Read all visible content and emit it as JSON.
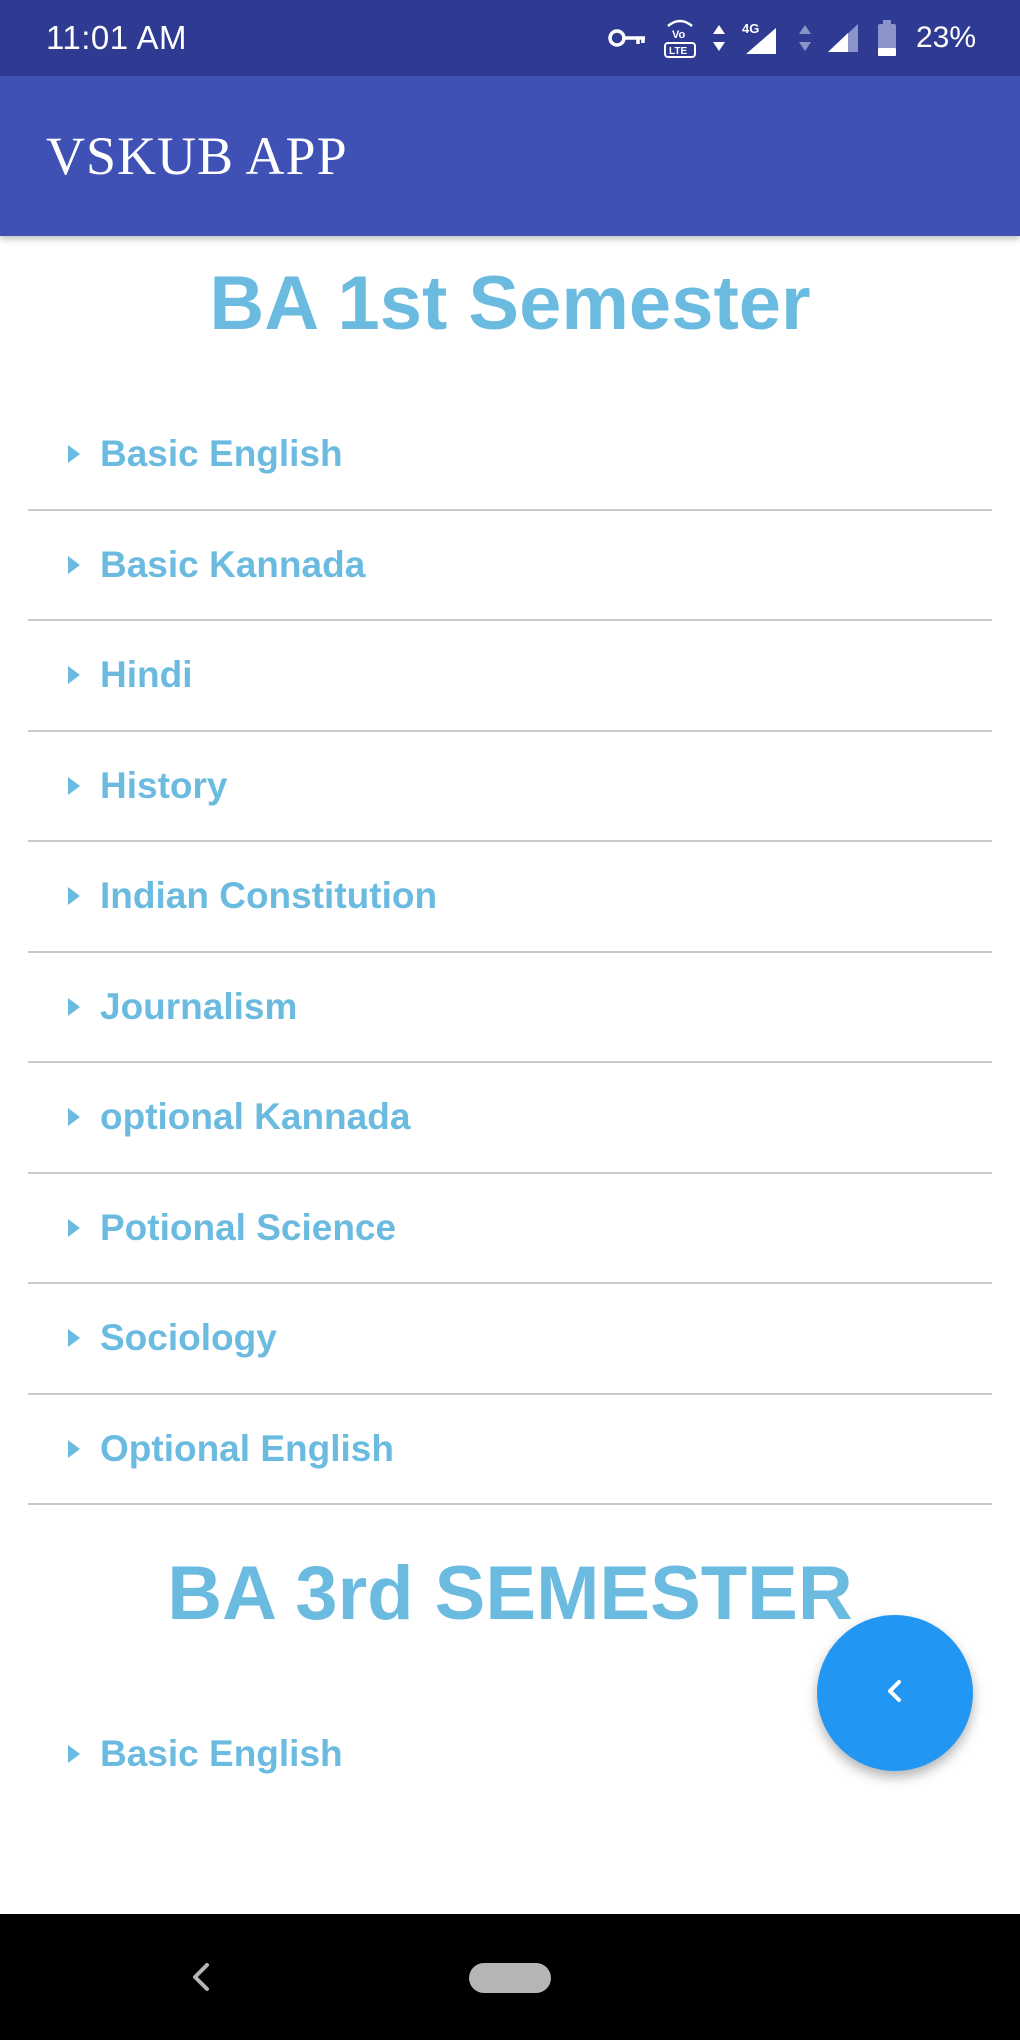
{
  "status_bar": {
    "time": "11:01 AM",
    "network": "4G",
    "battery_percent": "23%",
    "icons": [
      "vpn-key-icon",
      "volte-icon",
      "data-arrows-icon",
      "signal-4g-icon",
      "signal-icon",
      "battery-icon"
    ]
  },
  "app_bar": {
    "title": "VSKUB APP"
  },
  "sections": [
    {
      "title": "BA 1st Semester",
      "items": [
        {
          "label": "Basic English"
        },
        {
          "label": "Basic Kannada"
        },
        {
          "label": "Hindi"
        },
        {
          "label": "History"
        },
        {
          "label": "Indian Constitution"
        },
        {
          "label": "Journalism"
        },
        {
          "label": "optional Kannada"
        },
        {
          "label": "Potional Science"
        },
        {
          "label": "Sociology"
        },
        {
          "label": "Optional English"
        }
      ]
    },
    {
      "title": "BA 3rd SEMESTER",
      "items": [
        {
          "label": "Basic English"
        }
      ]
    }
  ],
  "fab": {
    "icon": "chevron-left-icon"
  },
  "nav_bar": {
    "icons": [
      "back-icon",
      "home-pill-icon"
    ]
  },
  "colors": {
    "status_bar": "#2f3b93",
    "app_bar": "#3f51b5",
    "accent_text": "#6bbbe0",
    "fab": "#2196f3",
    "divider": "#c9c9c9"
  }
}
